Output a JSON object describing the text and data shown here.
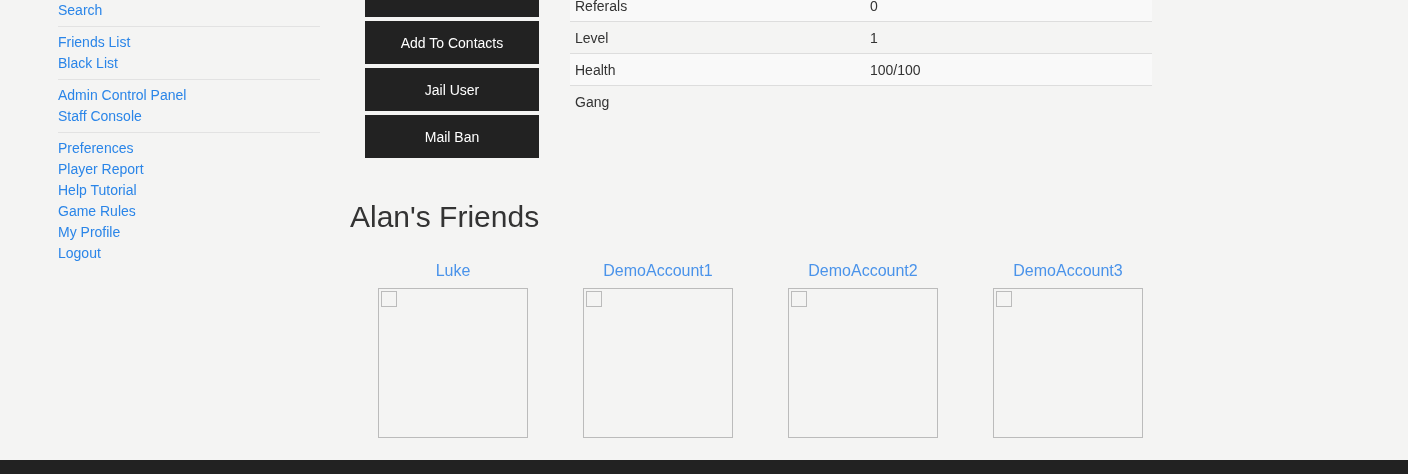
{
  "sidebar": {
    "groups": [
      {
        "items": [
          "Search"
        ]
      },
      {
        "items": [
          "Friends List",
          "Black List"
        ]
      },
      {
        "items": [
          "Admin Control Panel",
          "Staff Console"
        ]
      },
      {
        "items": [
          "Preferences",
          "Player Report",
          "Help Tutorial",
          "Game Rules",
          "My Profile",
          "Logout"
        ]
      }
    ]
  },
  "actions": [
    "Add To Contacts",
    "Jail User",
    "Mail Ban"
  ],
  "stats": [
    {
      "label": "Referals",
      "value": "0"
    },
    {
      "label": "Level",
      "value": "1"
    },
    {
      "label": "Health",
      "value": "100/100"
    },
    {
      "label": "Gang"
    }
  ],
  "friends": {
    "title": "Alan's Friends",
    "items": [
      {
        "name": "Luke"
      },
      {
        "name": "DemoAccount1"
      },
      {
        "name": "DemoAccount2"
      },
      {
        "name": "DemoAccount3"
      }
    ]
  }
}
